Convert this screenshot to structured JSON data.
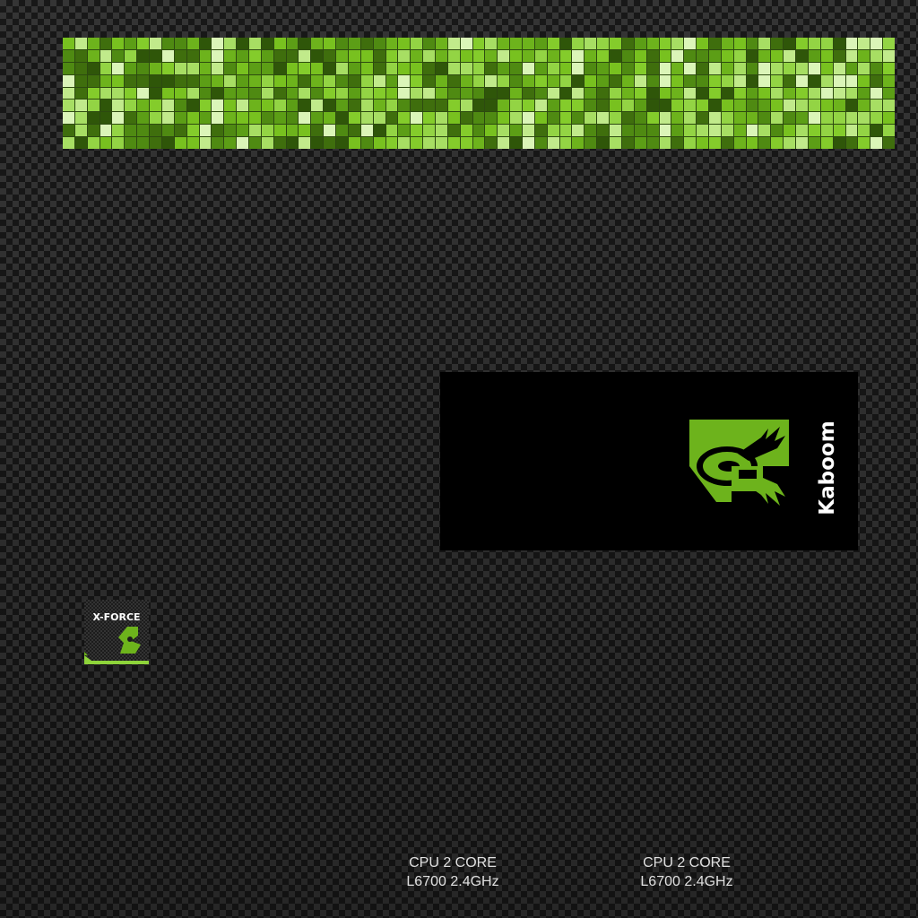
{
  "colors": {
    "accent_green": "#6db31c",
    "panel_black": "#000000",
    "background": "#2a2a2a"
  },
  "banner": {
    "style": "green-mosaic"
  },
  "launcher": {
    "icon": "kaboom-logo-icon",
    "label": "Kaboom"
  },
  "badge": {
    "icon": "x-force-logo-icon",
    "text": "X-FORCE"
  },
  "cpu_specs": [
    {
      "line1": "CPU 2 CORE",
      "line2": "L6700 2.4GHz"
    },
    {
      "line1": "CPU 2 CORE",
      "line2": "L6700 2.4GHz"
    }
  ]
}
